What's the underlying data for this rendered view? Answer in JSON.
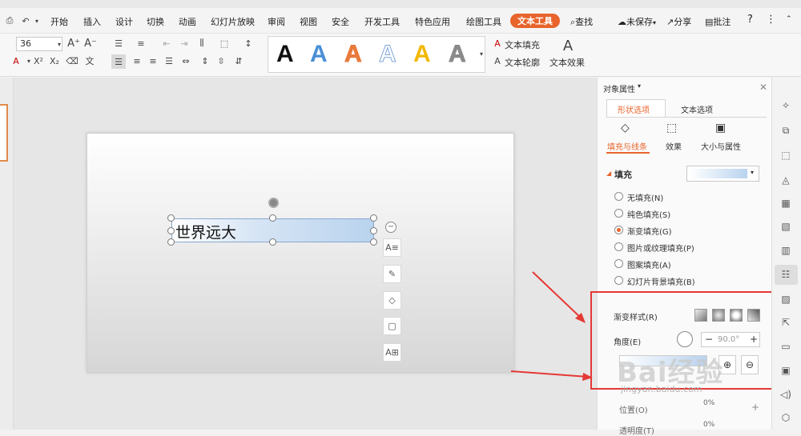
{
  "menubar": {
    "items": [
      "开始",
      "插入",
      "设计",
      "切换",
      "动画",
      "幻灯片放映",
      "审阅",
      "视图",
      "安全",
      "开发工具",
      "特色应用",
      "绘图工具",
      "文本工具"
    ],
    "search": "查找",
    "unsaved": "未保存",
    "share": "分享",
    "comment": "批注",
    "help": "?",
    "more": "⋮"
  },
  "ribbon": {
    "font_size": "36",
    "text_fill": "文本填充",
    "text_outline": "文本轮廓",
    "text_effect": "文本效果",
    "style_letters": [
      "A",
      "A",
      "A",
      "A",
      "A",
      "A"
    ],
    "style_colors": [
      "#111111",
      "#4a8fd6",
      "#e87a3c",
      "#7ea6d6",
      "#f2b800",
      "#8a8a8a"
    ]
  },
  "slide": {
    "textbox_text": "世界远大"
  },
  "panel": {
    "title": "对象属性",
    "tabs": [
      "形状选项",
      "文本选项"
    ],
    "subtabs": [
      "填充与线条",
      "效果",
      "大小与属性"
    ],
    "section": "填充",
    "fill_options": [
      "无填充(N)",
      "纯色填充(S)",
      "渐变填充(G)",
      "图片或纹理填充(P)",
      "图案填充(A)",
      "幻灯片背景填充(B)"
    ],
    "selected_fill": 2,
    "gradient_style_label": "渐变样式(R)",
    "angle_label": "角度(E)",
    "angle_value": "90.0°",
    "position_label": "位置(O)",
    "position_value": "0%",
    "transparency_label": "透明度(T)",
    "transparency_value": "0%"
  },
  "watermark": {
    "text": "Bai经验",
    "url": "jingyan.baidu.com"
  },
  "colors": {
    "accent": "#e8642c",
    "highlight_box": "#e53935",
    "arrow": "#e53935"
  }
}
